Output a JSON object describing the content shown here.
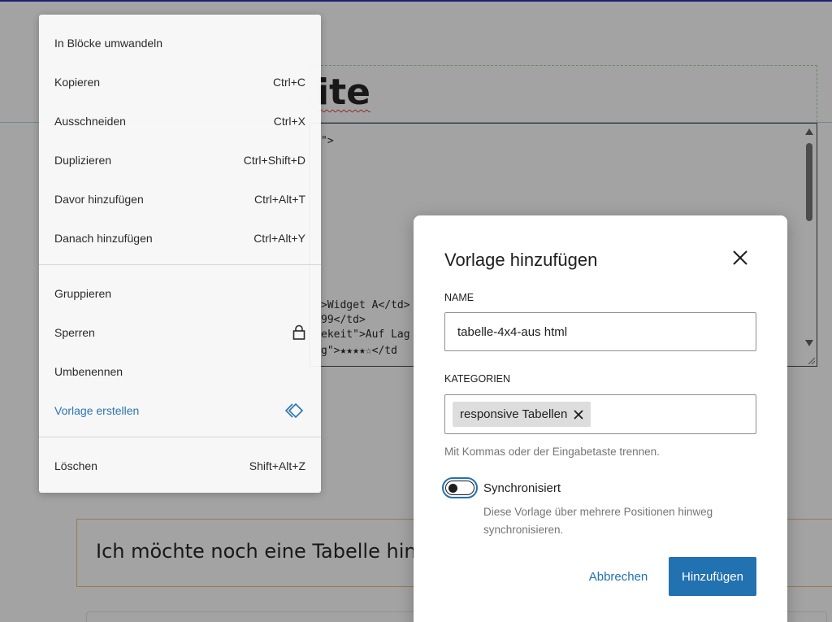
{
  "editor": {
    "heading_text": "ite",
    "code_lines": [
      "\">",
      ">Widget A</td>",
      "99</td>",
      "ekeit\">Auf Lag",
      "g\">★★★★☆</td"
    ],
    "paragraph_text": "Ich möchte noch eine Tabelle hinzu"
  },
  "context_menu": {
    "items": [
      {
        "label": "In Blöcke umwandeln",
        "shortcut": ""
      },
      {
        "label": "Kopieren",
        "shortcut": "Ctrl+C"
      },
      {
        "label": "Ausschneiden",
        "shortcut": "Ctrl+X"
      },
      {
        "label": "Duplizieren",
        "shortcut": "Ctrl+Shift+D"
      },
      {
        "label": "Davor hinzufügen",
        "shortcut": "Ctrl+Alt+T"
      },
      {
        "label": "Danach hinzufügen",
        "shortcut": "Ctrl+Alt+Y"
      },
      {
        "label": "Gruppieren",
        "shortcut": ""
      },
      {
        "label": "Sperren",
        "icon": "lock-icon"
      },
      {
        "label": "Umbenennen",
        "shortcut": ""
      },
      {
        "label": "Vorlage erstellen",
        "icon": "pattern-icon"
      },
      {
        "label": "Löschen",
        "shortcut": "Shift+Alt+Z"
      }
    ]
  },
  "modal": {
    "title": "Vorlage hinzufügen",
    "name_label": "NAME",
    "name_value": "tabelle-4x4-aus html",
    "categories_label": "KATEGORIEN",
    "category_chip": "responsive Tabellen",
    "categories_help": "Mit Kommas oder der Eingabetaste trennen.",
    "sync_label": "Synchronisiert",
    "sync_enabled": false,
    "sync_help": "Diese Vorlage über mehrere Positionen hinweg synchronisieren.",
    "cancel_label": "Abbrechen",
    "add_label": "Hinzufügen"
  },
  "colors": {
    "accent": "#2271b1",
    "overlay": "rgba(35,35,35,0.42)",
    "help_text": "#757575"
  }
}
